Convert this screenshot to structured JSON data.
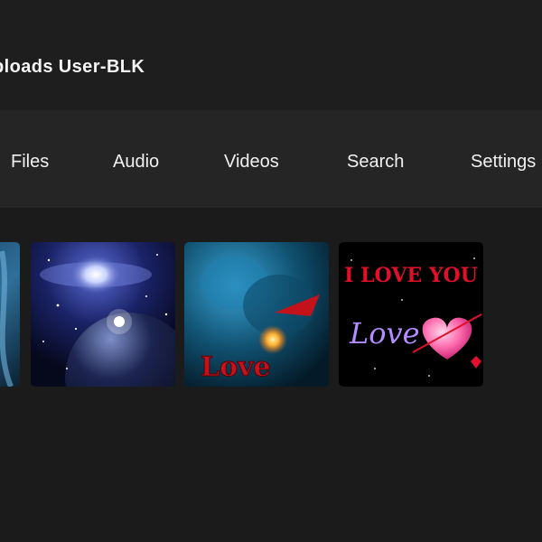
{
  "header": {
    "title": "ploads User-BLK"
  },
  "nav": {
    "items": [
      {
        "label": "Files"
      },
      {
        "label": "Audio"
      },
      {
        "label": "Videos"
      },
      {
        "label": "Search"
      },
      {
        "label": "Settings"
      }
    ]
  },
  "gallery": {
    "thumbnails": [
      {
        "subject": "blue-abstract-image"
      },
      {
        "subject": "galaxy-planet-image",
        "colors": [
          "#0b1030",
          "#3a4aa8",
          "#ffffff"
        ]
      },
      {
        "subject": "couple-love-image",
        "text": "Love",
        "colors": [
          "#0d3a55",
          "#2b8ec0",
          "#c4121a"
        ]
      },
      {
        "subject": "i-love-you-image",
        "text_top": "I LOVE YOU",
        "text_script": "Love",
        "colors": [
          "#000000",
          "#e0102a",
          "#ff6fb0"
        ]
      }
    ]
  }
}
